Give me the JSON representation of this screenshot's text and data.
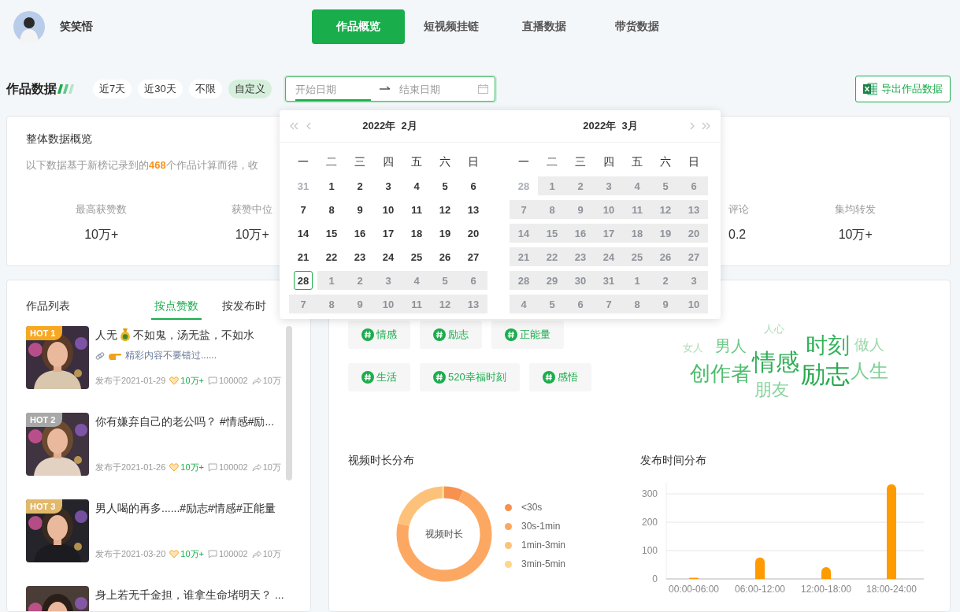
{
  "header": {
    "user_name": "笑笑悟",
    "tabs": [
      {
        "label": "作品概览",
        "selected": true
      },
      {
        "label": "短视频挂链",
        "selected": false
      },
      {
        "label": "直播数据",
        "selected": false
      },
      {
        "label": "带货数据",
        "selected": false
      }
    ]
  },
  "filter": {
    "title": "作品数据",
    "ranges": [
      {
        "label": "近7天",
        "selected": false
      },
      {
        "label": "近30天",
        "selected": false
      },
      {
        "label": "不限",
        "selected": false
      },
      {
        "label": "自定义",
        "selected": true
      }
    ],
    "date_range": {
      "start_placeholder": "开始日期",
      "end_placeholder": "结束日期",
      "start_focused": true
    },
    "export_button": "导出作品数据"
  },
  "overview": {
    "title": "整体数据概览",
    "description": "以下数据基于新榜记录到的**468**个作品计算而得，收",
    "stats": [
      {
        "label": "最高获赞数",
        "value": "10万+"
      },
      {
        "label": "获赞中位",
        "value": "10万+"
      },
      {
        "label": "评论",
        "value": "0.2"
      },
      {
        "label": "集均转发",
        "value": "10万+"
      }
    ]
  },
  "works": {
    "title": "作品列表",
    "sorts": [
      {
        "label": "按点赞数",
        "selected": true
      },
      {
        "label": "按发布时",
        "selected": false
      }
    ],
    "items": [
      {
        "rank": "HOT 1",
        "color": "#f7a823",
        "title": "人无",
        "title_after_icon": " 不如鬼，汤无盐，不如水",
        "teaser": "精彩内容不要错过......",
        "date": "发布于2021-01-29",
        "likes": "10万+",
        "comments": "100002",
        "shares": "10万"
      },
      {
        "rank": "HOT 2",
        "color": "#a8a8a8",
        "title": "你有嫌弃自己的老公吗？ #情感#励...",
        "date": "发布于2021-01-26",
        "likes": "10万+",
        "comments": "100002",
        "shares": "10万"
      },
      {
        "rank": "HOT 3",
        "color": "#e2b86a",
        "title": "男人喝的再多......#励志#情感#正能量",
        "date": "发布于2021-03-20",
        "likes": "10万+",
        "comments": "100002",
        "shares": "10万"
      },
      {
        "title": "身上若无千金担，谁拿生命堵明天？ ..."
      }
    ]
  },
  "analysis": {
    "tags": [
      "情感",
      "励志",
      "正能量",
      "生活",
      "520幸福时刻",
      "感悟"
    ],
    "word_cloud": [
      "人心",
      "女人",
      "男人",
      "时刻",
      "做人",
      "情感",
      "创作者",
      "励志",
      "人生",
      "朋友"
    ],
    "duration": {
      "title": "视频时长分布",
      "center_label": "视频时长",
      "legend": [
        {
          "label": "<30s",
          "color": "#f7914f"
        },
        {
          "label": "30s-1min",
          "color": "#fca862"
        },
        {
          "label": "1min-3min",
          "color": "#fdc27a"
        },
        {
          "label": "3min-5min",
          "color": "#fdd68c"
        }
      ]
    },
    "publish_time": {
      "chart_data": {
        "type": "bar",
        "title": "发布时间分布",
        "categories": [
          "00:00-06:00",
          "06:00-12:00",
          "12:00-18:00",
          "18:00-24:00"
        ],
        "series": [
          {
            "color": "#ff9a00",
            "values": [
              2,
              76,
              42,
              334
            ]
          }
        ],
        "yticks": [
          0,
          100,
          200,
          300
        ],
        "ylim": [
          0,
          340
        ],
        "grid": true
      }
    }
  },
  "date_picker": {
    "months": [
      {
        "title": "2022年  2月",
        "weekdays": [
          "一",
          "二",
          "三",
          "四",
          "五",
          "六",
          "日"
        ],
        "weeks": [
          [
            {
              "day": "31",
              "kind": "other"
            },
            {
              "day": "1",
              "kind": "day"
            },
            {
              "day": "2",
              "kind": "day"
            },
            {
              "day": "3",
              "kind": "day"
            },
            {
              "day": "4",
              "kind": "day"
            },
            {
              "day": "5",
              "kind": "day"
            },
            {
              "day": "6",
              "kind": "day"
            }
          ],
          [
            {
              "day": "7",
              "kind": "day"
            },
            {
              "day": "8",
              "kind": "day"
            },
            {
              "day": "9",
              "kind": "day"
            },
            {
              "day": "10",
              "kind": "day"
            },
            {
              "day": "11",
              "kind": "day"
            },
            {
              "day": "12",
              "kind": "day"
            },
            {
              "day": "13",
              "kind": "day"
            }
          ],
          [
            {
              "day": "14",
              "kind": "day"
            },
            {
              "day": "15",
              "kind": "day"
            },
            {
              "day": "16",
              "kind": "day"
            },
            {
              "day": "17",
              "kind": "day"
            },
            {
              "day": "18",
              "kind": "day"
            },
            {
              "day": "19",
              "kind": "day"
            },
            {
              "day": "20",
              "kind": "day"
            }
          ],
          [
            {
              "day": "21",
              "kind": "day"
            },
            {
              "day": "22",
              "kind": "day"
            },
            {
              "day": "23",
              "kind": "day"
            },
            {
              "day": "24",
              "kind": "day"
            },
            {
              "day": "25",
              "kind": "day"
            },
            {
              "day": "26",
              "kind": "day"
            },
            {
              "day": "27",
              "kind": "day"
            }
          ],
          [
            {
              "day": "28",
              "kind": "today"
            },
            {
              "day": "1",
              "kind": "disabled"
            },
            {
              "day": "2",
              "kind": "disabled"
            },
            {
              "day": "3",
              "kind": "disabled"
            },
            {
              "day": "4",
              "kind": "disabled"
            },
            {
              "day": "5",
              "kind": "disabled"
            },
            {
              "day": "6",
              "kind": "disabled"
            }
          ],
          [
            {
              "day": "7",
              "kind": "disabled"
            },
            {
              "day": "8",
              "kind": "disabled"
            },
            {
              "day": "9",
              "kind": "disabled"
            },
            {
              "day": "10",
              "kind": "disabled"
            },
            {
              "day": "11",
              "kind": "disabled"
            },
            {
              "day": "12",
              "kind": "disabled"
            },
            {
              "day": "13",
              "kind": "disabled"
            }
          ]
        ]
      },
      {
        "title": "2022年  3月",
        "weekdays": [
          "一",
          "二",
          "三",
          "四",
          "五",
          "六",
          "日"
        ],
        "weeks": [
          [
            {
              "day": "28",
              "kind": "other"
            },
            {
              "day": "1",
              "kind": "disabled"
            },
            {
              "day": "2",
              "kind": "disabled"
            },
            {
              "day": "3",
              "kind": "disabled"
            },
            {
              "day": "4",
              "kind": "disabled"
            },
            {
              "day": "5",
              "kind": "disabled"
            },
            {
              "day": "6",
              "kind": "disabled"
            }
          ],
          [
            {
              "day": "7",
              "kind": "disabled"
            },
            {
              "day": "8",
              "kind": "disabled"
            },
            {
              "day": "9",
              "kind": "disabled"
            },
            {
              "day": "10",
              "kind": "disabled"
            },
            {
              "day": "11",
              "kind": "disabled"
            },
            {
              "day": "12",
              "kind": "disabled"
            },
            {
              "day": "13",
              "kind": "disabled"
            }
          ],
          [
            {
              "day": "14",
              "kind": "disabled"
            },
            {
              "day": "15",
              "kind": "disabled"
            },
            {
              "day": "16",
              "kind": "disabled"
            },
            {
              "day": "17",
              "kind": "disabled"
            },
            {
              "day": "18",
              "kind": "disabled"
            },
            {
              "day": "19",
              "kind": "disabled"
            },
            {
              "day": "20",
              "kind": "disabled"
            }
          ],
          [
            {
              "day": "21",
              "kind": "disabled"
            },
            {
              "day": "22",
              "kind": "disabled"
            },
            {
              "day": "23",
              "kind": "disabled"
            },
            {
              "day": "24",
              "kind": "disabled"
            },
            {
              "day": "25",
              "kind": "disabled"
            },
            {
              "day": "26",
              "kind": "disabled"
            },
            {
              "day": "27",
              "kind": "disabled"
            }
          ],
          [
            {
              "day": "28",
              "kind": "disabled"
            },
            {
              "day": "29",
              "kind": "disabled"
            },
            {
              "day": "30",
              "kind": "disabled"
            },
            {
              "day": "31",
              "kind": "disabled"
            },
            {
              "day": "1",
              "kind": "disabled"
            },
            {
              "day": "2",
              "kind": "disabled"
            },
            {
              "day": "3",
              "kind": "disabled"
            }
          ],
          [
            {
              "day": "4",
              "kind": "disabled"
            },
            {
              "day": "5",
              "kind": "disabled"
            },
            {
              "day": "6",
              "kind": "disabled"
            },
            {
              "day": "7",
              "kind": "disabled"
            },
            {
              "day": "8",
              "kind": "disabled"
            },
            {
              "day": "9",
              "kind": "disabled"
            },
            {
              "day": "10",
              "kind": "disabled"
            }
          ]
        ]
      }
    ]
  }
}
